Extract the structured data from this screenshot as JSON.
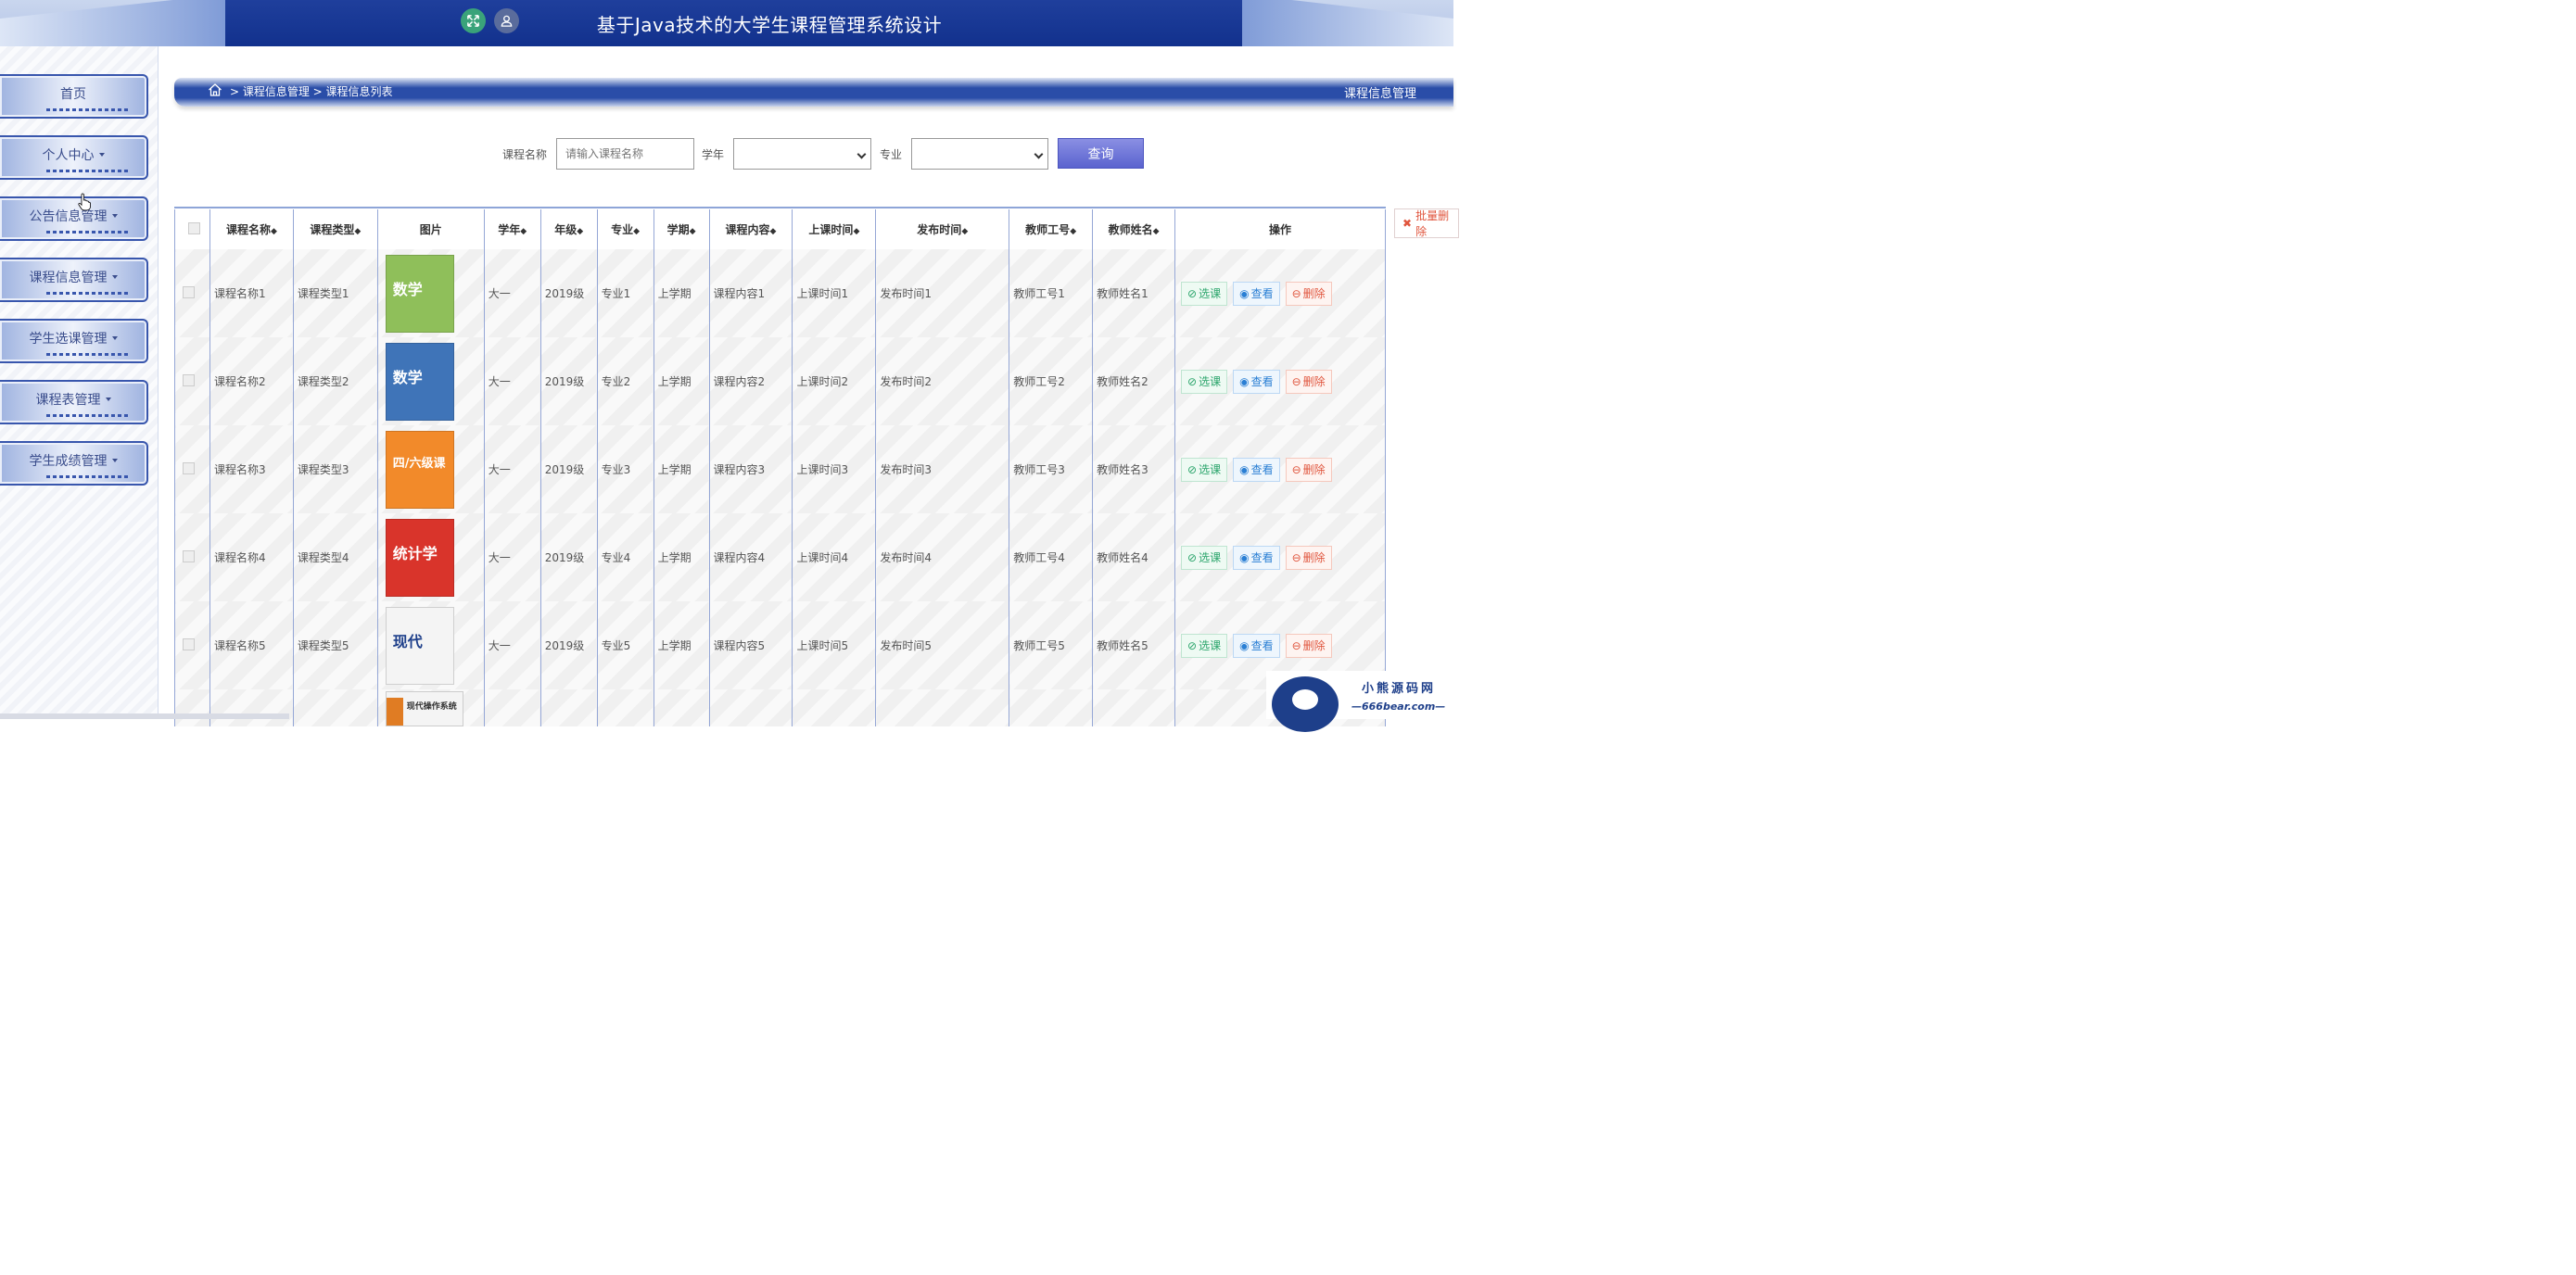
{
  "header": {
    "title": "基于Java技术的大学生课程管理系统设计",
    "colors": {
      "bar": "#12318d",
      "fullscreen_btn": "#3aa37a",
      "user_btn": "#5a6c9c"
    }
  },
  "sidebar": {
    "items": [
      {
        "label": "首页",
        "has_caret": false
      },
      {
        "label": "个人中心",
        "has_caret": true
      },
      {
        "label": "公告信息管理",
        "has_caret": true
      },
      {
        "label": "课程信息管理",
        "has_caret": true
      },
      {
        "label": "学生选课管理",
        "has_caret": true
      },
      {
        "label": "课程表管理",
        "has_caret": true
      },
      {
        "label": "学生成绩管理",
        "has_caret": true
      }
    ]
  },
  "breadcrumb": {
    "path": "> 课程信息管理 > 课程信息列表",
    "page_name": "课程信息管理"
  },
  "search": {
    "name_label": "课程名称",
    "name_placeholder": "请输入课程名称",
    "year_label": "学年",
    "major_label": "专业",
    "query_button": "查询"
  },
  "table": {
    "columns": [
      "课程名称",
      "课程类型",
      "图片",
      "学年",
      "年级",
      "专业",
      "学期",
      "课程内容",
      "上课时间",
      "发布时间",
      "教师工号",
      "教师姓名",
      "操作"
    ],
    "sortable": [
      true,
      true,
      false,
      true,
      true,
      true,
      true,
      true,
      true,
      true,
      true,
      true,
      false
    ],
    "sort_symbol": "◆",
    "rows": [
      {
        "name": "课程名称1",
        "type": "课程类型1",
        "year": "大一",
        "grade": "2019级",
        "major": "专业1",
        "term": "上学期",
        "content": "课程内容1",
        "class_time": "上课时间1",
        "publish_time": "发布时间1",
        "teacher_no": "教师工号1",
        "teacher_name": "教师姓名1"
      },
      {
        "name": "课程名称2",
        "type": "课程类型2",
        "year": "大一",
        "grade": "2019级",
        "major": "专业2",
        "term": "上学期",
        "content": "课程内容2",
        "class_time": "上课时间2",
        "publish_time": "发布时间2",
        "teacher_no": "教师工号2",
        "teacher_name": "教师姓名2"
      },
      {
        "name": "课程名称3",
        "type": "课程类型3",
        "year": "大一",
        "grade": "2019级",
        "major": "专业3",
        "term": "上学期",
        "content": "课程内容3",
        "class_time": "上课时间3",
        "publish_time": "发布时间3",
        "teacher_no": "教师工号3",
        "teacher_name": "教师姓名3"
      },
      {
        "name": "课程名称4",
        "type": "课程类型4",
        "year": "大一",
        "grade": "2019级",
        "major": "专业4",
        "term": "上学期",
        "content": "课程内容4",
        "class_time": "上课时间4",
        "publish_time": "发布时间4",
        "teacher_no": "教师工号4",
        "teacher_name": "教师姓名4"
      },
      {
        "name": "课程名称5",
        "type": "课程类型5",
        "year": "大一",
        "grade": "2019级",
        "major": "专业5",
        "term": "上学期",
        "content": "课程内容5",
        "class_time": "上课时间5",
        "publish_time": "发布时间5",
        "teacher_no": "教师工号5",
        "teacher_name": "教师姓名5"
      }
    ],
    "row_actions": {
      "select": "选课",
      "view": "查看",
      "delete": "删除"
    },
    "book_covers": [
      {
        "text": "数学",
        "color": "#8fbf5a"
      },
      {
        "text": "数学",
        "color": "#3f74b8"
      },
      {
        "text": "四/六级课",
        "color": "#f28a2a"
      },
      {
        "text": "统计学",
        "color": "#d9342b"
      },
      {
        "text": "现代",
        "color": "#f4f4f4"
      }
    ],
    "partial_cover": {
      "text": "现代操作系统"
    }
  },
  "batch_delete": {
    "label": "批量删除"
  },
  "watermark": {
    "title": "小熊源码网",
    "url": "—666bear.com—"
  }
}
